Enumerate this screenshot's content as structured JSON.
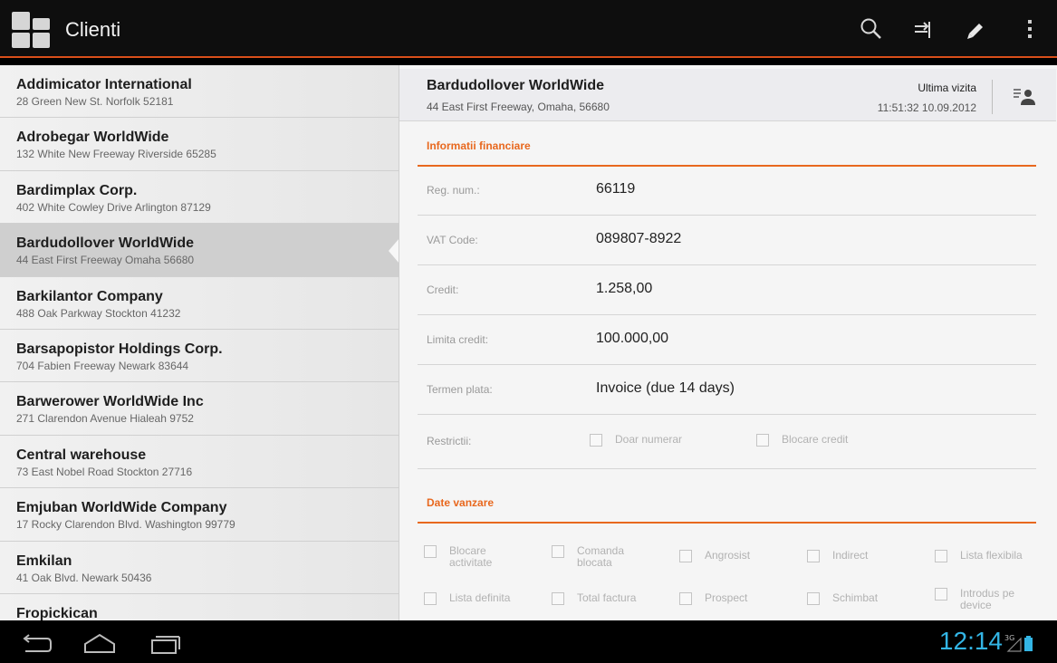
{
  "app": {
    "title": "Clienti"
  },
  "clients": [
    {
      "name": "Addimicator International",
      "address": "28 Green New St. Norfolk 52181"
    },
    {
      "name": "Adrobegar WorldWide",
      "address": "132 White New Freeway Riverside 65285"
    },
    {
      "name": "Bardimplax  Corp.",
      "address": "402 White Cowley Drive Arlington 87129"
    },
    {
      "name": "Bardudollover WorldWide",
      "address": "44 East First Freeway Omaha 56680"
    },
    {
      "name": "Barkilantor  Company",
      "address": "488 Oak Parkway Stockton 41232"
    },
    {
      "name": "Barsapopistor Holdings Corp.",
      "address": "704 Fabien Freeway Newark 83644"
    },
    {
      "name": "Barwerower WorldWide Inc",
      "address": "271 Clarendon Avenue Hialeah 9752"
    },
    {
      "name": "Central warehouse",
      "address": "73 East Nobel Road Stockton 27716"
    },
    {
      "name": "Emjuban WorldWide Company",
      "address": "17 Rocky Clarendon Blvd. Washington 99779"
    },
    {
      "name": "Emkilan",
      "address": "41 Oak Blvd. Newark 50436"
    },
    {
      "name": "Fropickican",
      "address": ""
    }
  ],
  "detail": {
    "name": "Bardudollover WorldWide",
    "address": "44 East First Freeway, Omaha, 56680",
    "last_visit_label": "Ultima vizita",
    "last_visit_time": "11:51:32  10.09.2012",
    "financial": {
      "title": "Informatii financiare",
      "fields": [
        {
          "label": "Reg. num.:",
          "value": "66119"
        },
        {
          "label": "VAT Code:",
          "value": "089807-8922"
        },
        {
          "label": "Credit:",
          "value": "1.258,00"
        },
        {
          "label": "Limita credit:",
          "value": "100.000,00"
        },
        {
          "label": "Termen plata:",
          "value": "Invoice (due 14 days)"
        }
      ],
      "restrictions_label": "Restrictii:",
      "restrictions": [
        "Doar numerar",
        "Blocare credit"
      ]
    },
    "sales": {
      "title": "Date vanzare",
      "options_row1": [
        "Blocare activitate",
        "Comanda blocata",
        "Angrosist",
        "Indirect",
        "Lista flexibila"
      ],
      "options_row2": [
        "Lista definita",
        "Total factura",
        "Prospect",
        "Schimbat",
        "Introdus pe device"
      ]
    }
  },
  "status": {
    "clock": "12:14",
    "network": "3G"
  },
  "colors": {
    "accent": "#e8681e",
    "clock": "#33b5e5"
  }
}
